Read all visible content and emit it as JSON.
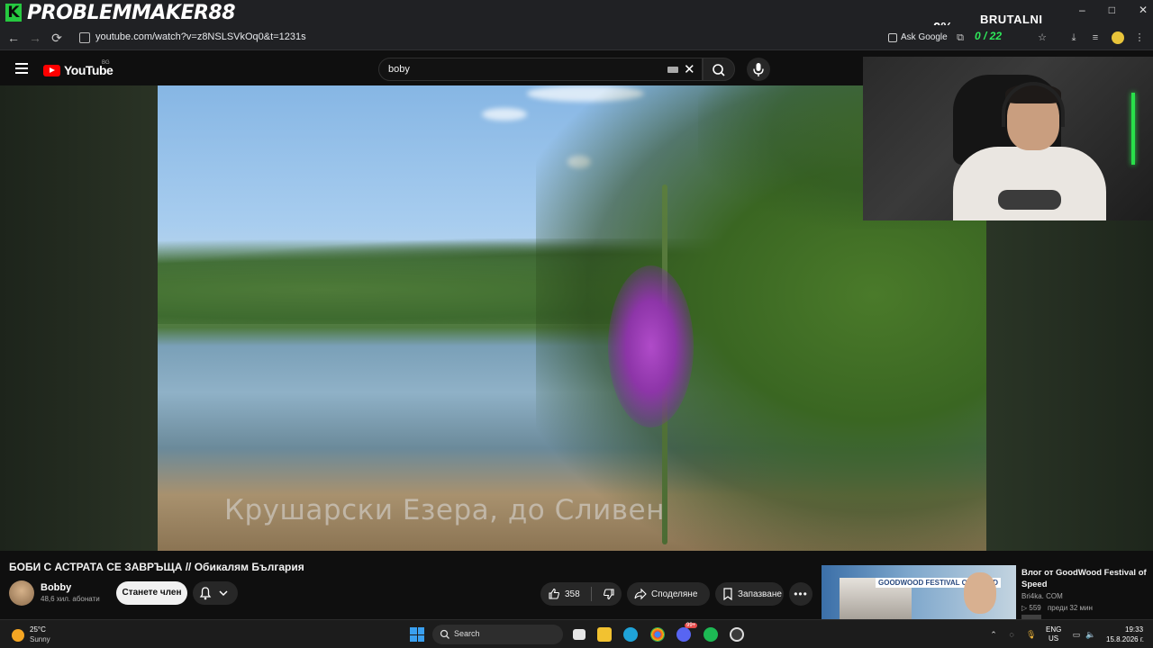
{
  "overlay": {
    "logo_letter": "K",
    "streamer_name": "PROBLEMMAKER88",
    "percent": "0%",
    "counter": "0 / 22",
    "brand_text": "BRUTALNI",
    "window_minimize": "–",
    "window_maximize": "□",
    "window_close": "✕"
  },
  "browser": {
    "url": "youtube.com/watch?v=z8NSLSVkOq0&t=1231s",
    "ask_google": "Ask Google",
    "back_icon": "←",
    "forward_icon": "→",
    "reload_icon": "⟳"
  },
  "youtube": {
    "logo_text": "YouTube",
    "region": "BG",
    "search_value": "boby",
    "clear_icon": "✕"
  },
  "video": {
    "subtitle": "Крушарски Езера, до Сливен",
    "title": "БОБИ С АСТРАТА СЕ ЗАВРЪЩА // Обикалям България",
    "channel_name": "Bobby",
    "subscribers": "48,6 хил. абонати",
    "join_label": "Станете член",
    "like_count": "358",
    "share_label": "Споделяне",
    "save_label": "Запазване"
  },
  "recommended": {
    "title": "Влог от GoodWood Festival of Speed",
    "thumb_text": "GOODWOOD FESTIVAL OF SPEED",
    "channel": "Bri4ka. COM",
    "views": "559",
    "age": "преди 32 мин"
  },
  "taskbar": {
    "temperature": "25°C",
    "weather": "Sunny",
    "search_placeholder": "Search",
    "lang_line1": "ENG",
    "lang_line2": "US",
    "time": "19:33",
    "date": "15.8.2026 г.",
    "notification_badge": "99+"
  },
  "colors": {
    "accent_green": "#26c940",
    "youtube_red": "#ff0000",
    "dark_bg": "#0f0f0f"
  }
}
